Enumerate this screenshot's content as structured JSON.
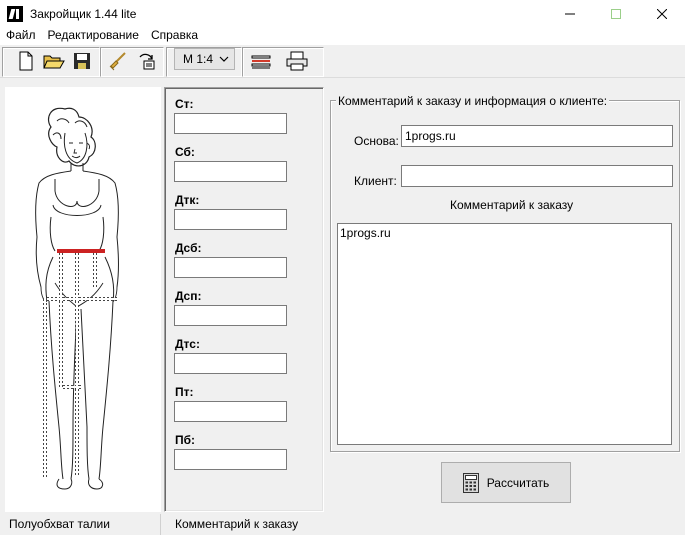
{
  "window": {
    "title": "Закройщик 1.44 lite"
  },
  "menu": {
    "items": [
      {
        "label": "Файл",
        "accel": "Ф"
      },
      {
        "label": "Редактирование",
        "accel": "Р"
      },
      {
        "label": "Справка",
        "accel": "С"
      }
    ]
  },
  "toolbar": {
    "scale_value": "М 1:4",
    "icons": [
      "new-file-icon",
      "open-folder-icon",
      "save-disk-icon",
      "broom-clear-icon",
      "refresh-icon",
      "measure-pattern-icon",
      "printer-icon"
    ]
  },
  "measurements": {
    "items": [
      {
        "label": "Ст:",
        "value": ""
      },
      {
        "label": "Сб:",
        "value": ""
      },
      {
        "label": "Дтк:",
        "value": ""
      },
      {
        "label": "Дсб:",
        "value": ""
      },
      {
        "label": "Дсп:",
        "value": ""
      },
      {
        "label": "Дтс:",
        "value": ""
      },
      {
        "label": "Пт:",
        "value": ""
      },
      {
        "label": "Пб:",
        "value": ""
      }
    ]
  },
  "client_info": {
    "group_title": "Комментарий к заказу и информация о клиенте:",
    "base_label": "Основа:",
    "base_value": "1progs.ru",
    "client_label": "Клиент:",
    "client_value": "",
    "comment_heading": "Комментарий к заказу",
    "comment_value": "1progs.ru"
  },
  "actions": {
    "calculate_label": "Рассчитать"
  },
  "status": {
    "left": "Полуобхват талии",
    "right": "Комментарий к заказу"
  },
  "colors": {
    "accent_red": "#cc2222",
    "window_bg": "#f0f0f0",
    "minimize_green": "#6ab04c"
  }
}
